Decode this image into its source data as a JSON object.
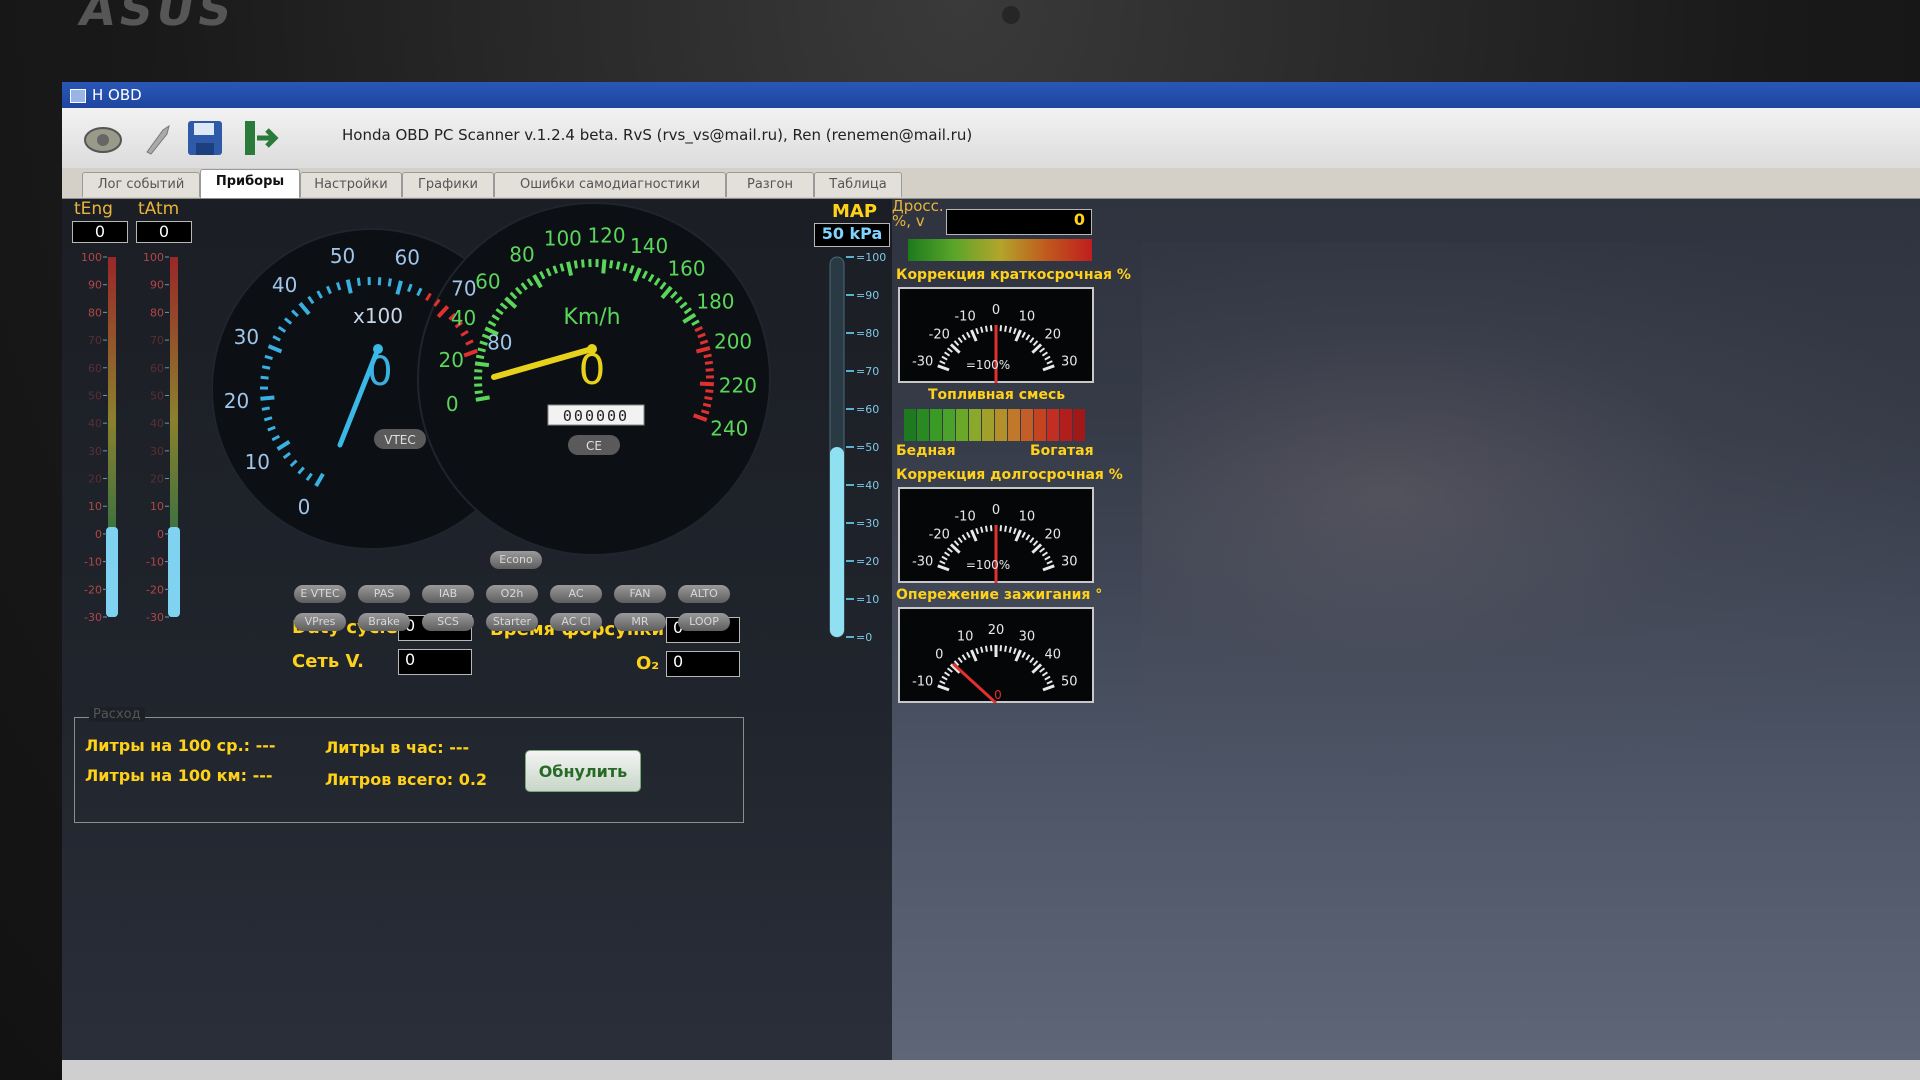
{
  "laptop": {
    "brand": "ASUS"
  },
  "window": {
    "title": "H OBD",
    "app_title": "Honda OBD PC Scanner v.1.2.4 beta. RvS (rvs_vs@mail.ru), Ren (renemen@mail.ru)",
    "toolbar_icons": [
      "car-connect-icon",
      "tool-icon",
      "save-icon",
      "exit-icon"
    ]
  },
  "tabs": [
    {
      "label": "Лог событий",
      "active": false
    },
    {
      "label": "Приборы",
      "active": true
    },
    {
      "label": "Настройки",
      "active": false
    },
    {
      "label": "Графики",
      "active": false
    },
    {
      "label": "Ошибки самодиагностики",
      "active": false
    },
    {
      "label": "Разгон",
      "active": false
    },
    {
      "label": "Таблица",
      "active": false
    }
  ],
  "temps": {
    "teng_label": "tEng",
    "teng_value": "0",
    "tatm_label": "tAtm",
    "tatm_value": "0",
    "scale": [
      "100",
      "90",
      "80",
      "70",
      "60",
      "50",
      "40",
      "30",
      "20",
      "10",
      "0",
      "-10",
      "-20",
      "-30"
    ],
    "teng_level": 0.25,
    "tatm_level": 0.25
  },
  "tach": {
    "unit": "x100",
    "value": "0",
    "badge": "VTEC",
    "labels": [
      "0",
      "10",
      "20",
      "30",
      "40",
      "50",
      "60",
      "70",
      "80"
    ]
  },
  "speedo": {
    "unit": "Km/h",
    "value": "0",
    "badge": "CE",
    "odometer": "000000",
    "labels": [
      "0",
      "20",
      "40",
      "60",
      "80",
      "100",
      "120",
      "140",
      "160",
      "180",
      "200",
      "220",
      "240"
    ]
  },
  "indicators": {
    "top": "Econo",
    "row1": [
      "E VTEC",
      "PAS",
      "IAB",
      "O2h",
      "AC",
      "FAN",
      "ALTO"
    ],
    "row2": [
      "VPres",
      "Brake",
      "SCS",
      "Starter",
      "AC Cl",
      "MR",
      "LOOP"
    ]
  },
  "fields": {
    "duty_label": "Duty cycle",
    "duty_value": "0",
    "set_label": "Сеть V.",
    "set_value": "0",
    "vremya_label": "Время форсунки",
    "vremya_value": "0",
    "o2_label": "O₂",
    "o2_value": "0"
  },
  "map": {
    "label": "MAP",
    "value": "50 kPa",
    "scale": [
      "100",
      "90",
      "80",
      "70",
      "60",
      "50",
      "40",
      "30",
      "20",
      "10",
      "0"
    ],
    "level": 0.5
  },
  "throttle": {
    "label": "Дросс. %, v",
    "value": "0"
  },
  "stft": {
    "label": "Коррекция краткосрочная %",
    "ticks": [
      "-30",
      "-20",
      "-10",
      "0",
      "10",
      "20",
      "30"
    ],
    "center": "=100%"
  },
  "mixture": {
    "label": "Топливная смесь",
    "lean": "Бедная",
    "rich": "Богатая"
  },
  "ltft": {
    "label": "Коррекция долгосрочная %",
    "ticks": [
      "-30",
      "-20",
      "-10",
      "0",
      "10",
      "20",
      "30"
    ],
    "center": "=100%"
  },
  "ignition": {
    "label": "Опережение зажигания °",
    "ticks": [
      "-10",
      "0",
      "10",
      "20",
      "30",
      "40",
      "50"
    ],
    "value": "0"
  },
  "consumption": {
    "legend": "Расход",
    "l100_avg": "Литры на 100 ср.: ---",
    "l100_km": "Литры на 100 км: ---",
    "l_per_hour": "Литры в час: ---",
    "l_total": "Литров всего: 0.2",
    "reset_button": "Обнулить"
  }
}
